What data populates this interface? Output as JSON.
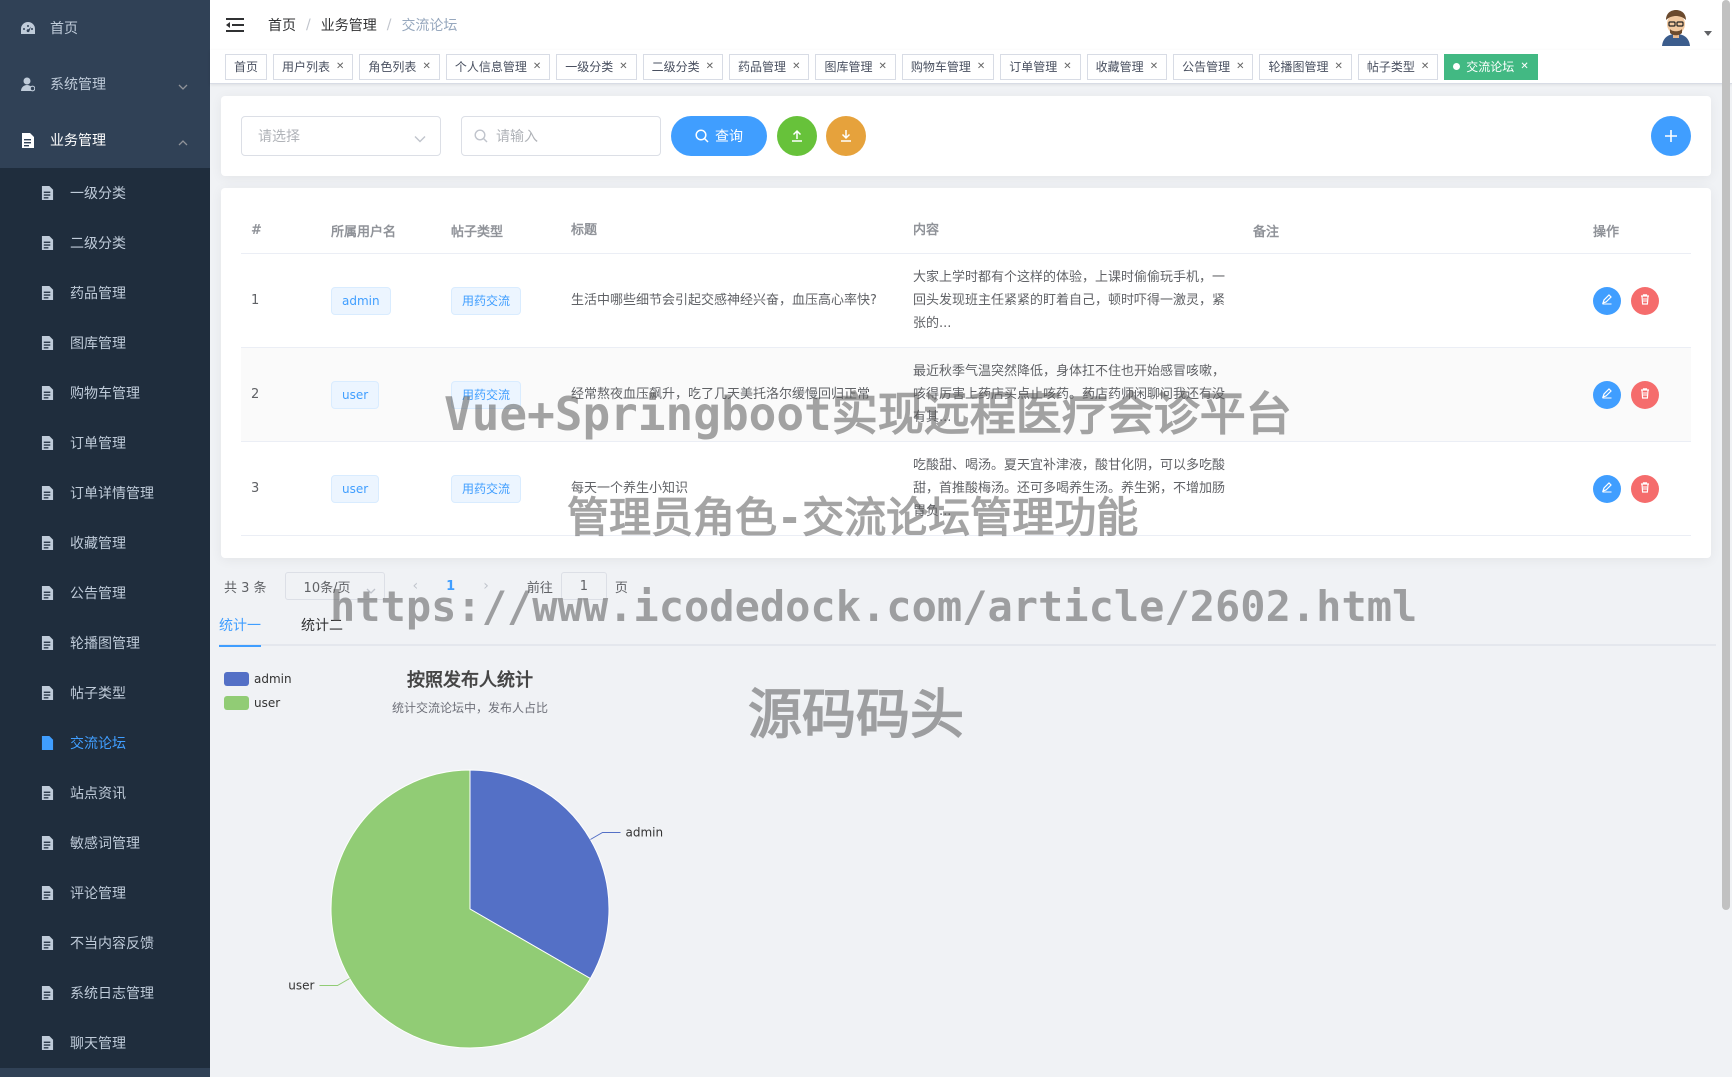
{
  "sidebar": {
    "items": [
      {
        "label": "首页",
        "icon": "dashboard-icon"
      },
      {
        "label": "系统管理",
        "icon": "user-icon"
      },
      {
        "label": "业务管理",
        "icon": "document-icon"
      }
    ],
    "sub_items": [
      {
        "label": "一级分类"
      },
      {
        "label": "二级分类"
      },
      {
        "label": "药品管理"
      },
      {
        "label": "图库管理"
      },
      {
        "label": "购物车管理"
      },
      {
        "label": "订单管理"
      },
      {
        "label": "订单详情管理"
      },
      {
        "label": "收藏管理"
      },
      {
        "label": "公告管理"
      },
      {
        "label": "轮播图管理"
      },
      {
        "label": "帖子类型"
      },
      {
        "label": "交流论坛"
      },
      {
        "label": "站点资讯"
      },
      {
        "label": "敏感词管理"
      },
      {
        "label": "评论管理"
      },
      {
        "label": "不当内容反馈"
      },
      {
        "label": "系统日志管理"
      },
      {
        "label": "聊天管理"
      }
    ],
    "active_sub": "交流论坛"
  },
  "navbar": {
    "breadcrumb": [
      "首页",
      "业务管理",
      "交流论坛"
    ]
  },
  "tags": [
    {
      "label": "首页",
      "closable": false
    },
    {
      "label": "用户列表",
      "closable": true
    },
    {
      "label": "角色列表",
      "closable": true
    },
    {
      "label": "个人信息管理",
      "closable": true
    },
    {
      "label": "一级分类",
      "closable": true
    },
    {
      "label": "二级分类",
      "closable": true
    },
    {
      "label": "药品管理",
      "closable": true
    },
    {
      "label": "图库管理",
      "closable": true
    },
    {
      "label": "购物车管理",
      "closable": true
    },
    {
      "label": "订单管理",
      "closable": true
    },
    {
      "label": "收藏管理",
      "closable": true
    },
    {
      "label": "公告管理",
      "closable": true
    },
    {
      "label": "轮播图管理",
      "closable": true
    },
    {
      "label": "帖子类型",
      "closable": true
    },
    {
      "label": "交流论坛",
      "closable": true,
      "active": true
    }
  ],
  "search": {
    "select_placeholder": "请选择",
    "input_placeholder": "请输入",
    "query_label": "查询"
  },
  "table": {
    "headers": [
      "#",
      "所属用户名",
      "帖子类型",
      "标题",
      "内容",
      "备注",
      "操作"
    ],
    "rows": [
      {
        "idx": "1",
        "user": "admin",
        "type": "用药交流",
        "title": "生活中哪些细节会引起交感神经兴奋，血压高心率快?",
        "content": "大家上学时都有个这样的体验，上课时偷偷玩手机，一回头发现班主任紧紧的盯着自己，顿时吓得一激灵，紧张的...",
        "remark": ""
      },
      {
        "idx": "2",
        "user": "user",
        "type": "用药交流",
        "title": "经常熬夜血压飙升，吃了几天美托洛尔缓慢回归正常",
        "content": "最近秋季气温突然降低，身体扛不住也开始感冒咳嗽，咳得厉害上药店买点止咳药。药店药师闲聊问我还有没有其...",
        "remark": ""
      },
      {
        "idx": "3",
        "user": "user",
        "type": "用药交流",
        "title": "每天一个养生小知识",
        "content": "吃酸甜、喝汤。夏天宜补津液，酸甘化阴，可以多吃酸甜，首推酸梅汤。还可多喝养生汤。养生粥，不增加肠胃负...",
        "remark": ""
      }
    ]
  },
  "pagination": {
    "total": "共 3 条",
    "page_size": "10条/页",
    "current": "1",
    "goto_label": "前往",
    "goto_value": "1",
    "page_suffix": "页"
  },
  "tabs": [
    "统计一",
    "统计二"
  ],
  "chart_data": {
    "type": "pie",
    "title": "按照发布人统计",
    "subtitle": "统计交流论坛中，发布人占比",
    "legend_position": "top-left",
    "slices": [
      {
        "name": "admin",
        "value": 1,
        "color": "#5470c6"
      },
      {
        "name": "user",
        "value": 2,
        "color": "#91cc75"
      }
    ]
  },
  "watermark": {
    "line1": "Vue+Springboot实现远程医疗会诊平台",
    "line2": "管理员角色-交流论坛管理功能",
    "line3": "https://www.icodedock.com/article/2602.html",
    "line4": "源码码头"
  },
  "colors": {
    "sidebar_bg": "#304156",
    "submenu_bg": "#1f2d3d",
    "primary": "#409eff",
    "success": "#67c23a",
    "warning": "#e6a23c",
    "danger": "#f56c6c",
    "active_tag": "#42b983"
  }
}
